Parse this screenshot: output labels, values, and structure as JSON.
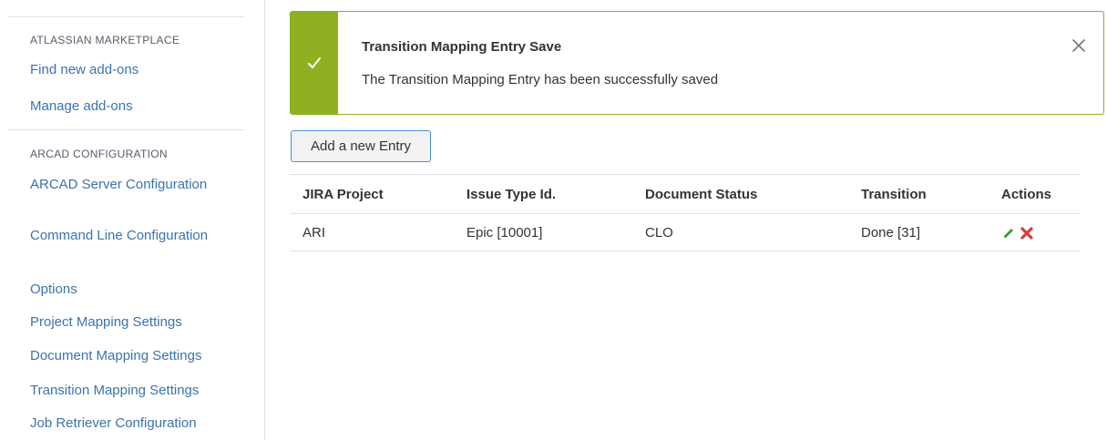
{
  "sidebar": {
    "marketplace_heading": "ATLASSIAN MARKETPLACE",
    "marketplace_items": [
      {
        "label": "Find new add-ons"
      },
      {
        "label": "Manage add-ons"
      }
    ],
    "arcad_heading": "ARCAD CONFIGURATION",
    "arcad_items": [
      {
        "label": "ARCAD Server Configuration"
      },
      {
        "label": "Command Line Configuration"
      },
      {
        "label": "Options"
      },
      {
        "label": "Project Mapping Settings"
      },
      {
        "label": "Document Mapping Settings"
      },
      {
        "label": "Transition Mapping Settings"
      },
      {
        "label": "Job Retriever Configuration"
      }
    ]
  },
  "message": {
    "type": "success",
    "title": "Transition Mapping Entry Save",
    "body": "The Transition Mapping Entry has been successfully saved",
    "check_icon": "check-icon",
    "close_icon": "close-icon"
  },
  "toolbar": {
    "add_label": "Add a new Entry"
  },
  "table": {
    "headers": [
      "JIRA Project",
      "Issue Type Id.",
      "Document Status",
      "Transition",
      "Actions"
    ],
    "rows": [
      {
        "project": "ARI",
        "issue_type": "Epic [10001]",
        "doc_status": "CLO",
        "transition": "Done [31]",
        "actions": [
          "edit-icon",
          "delete-icon"
        ]
      }
    ]
  },
  "colors": {
    "success": "#8eb021",
    "link": "#3b73af",
    "delete": "#d04437",
    "edit": "#3a9c2b",
    "button_border": "#4a90d9"
  }
}
